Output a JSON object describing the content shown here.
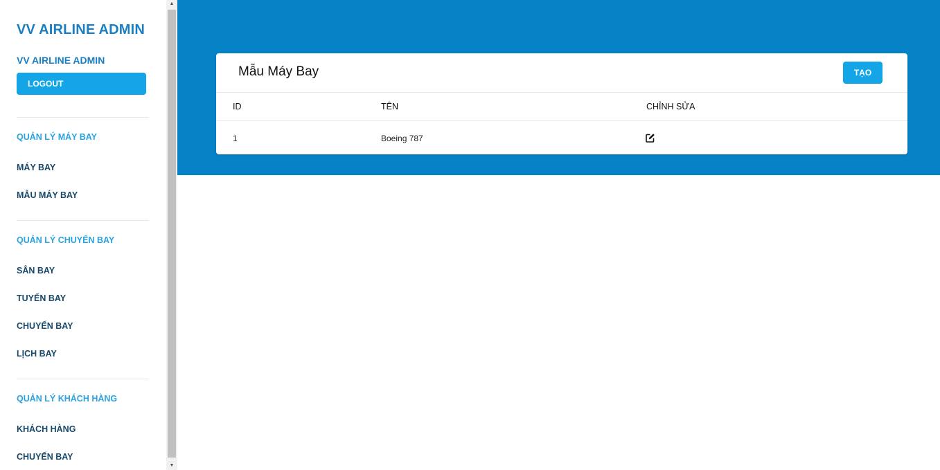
{
  "sidebar": {
    "brand": "VV AIRLINE ADMIN",
    "user_name": "VV AIRLINE ADMIN",
    "logout_label": "LOGOUT",
    "sections": [
      {
        "title": "QUẢN LÝ MÁY BAY",
        "items": [
          "MÁY BAY",
          "MẪU MÁY BAY"
        ]
      },
      {
        "title": "QUẢN LÝ CHUYẾN BAY",
        "items": [
          "SÂN BAY",
          "TUYẾN BAY",
          "CHUYẾN BAY",
          "LỊCH BAY"
        ]
      },
      {
        "title": "QUẢN LÝ KHÁCH HÀNG",
        "items": [
          "KHÁCH HÀNG",
          "CHUYẾN BAY"
        ]
      }
    ]
  },
  "card": {
    "title": "Mẫu Máy Bay",
    "create_label": "TẠO",
    "columns": [
      "ID",
      "TÊN",
      "CHỈNH SỬA"
    ],
    "rows": [
      {
        "id": "1",
        "name": "Boeing 787",
        "edit_icon": "edit-icon"
      }
    ]
  },
  "colors": {
    "hero": "#0683c7",
    "accent": "#13a5e6",
    "brand_text": "#1a7fc1",
    "section_text": "#2aa3e0",
    "nav_text": "#17496b"
  }
}
